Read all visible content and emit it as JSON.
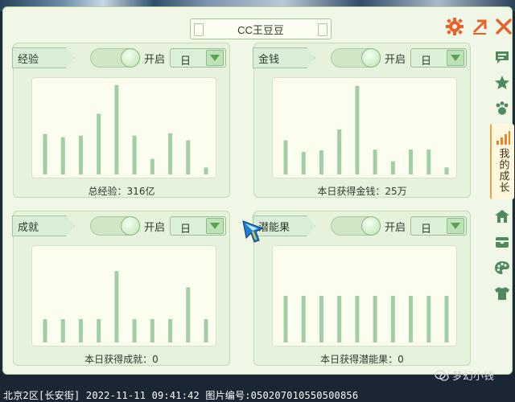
{
  "window": {
    "title": "CC王豆豆"
  },
  "toolbar": {
    "settings_icon": "gear-icon",
    "expand_icon": "expand-arrow-icon",
    "close_icon": "close-icon",
    "accent": "#e8612b"
  },
  "panels": [
    {
      "label": "经验",
      "toggle_label": "开启",
      "toggle_on": true,
      "period": "日",
      "caption": "总经验：316亿",
      "chart_data": {
        "type": "bar",
        "values": [
          52,
          48,
          50,
          78,
          115,
          50,
          20,
          53,
          44,
          9
        ],
        "ylim": [
          0,
          120
        ]
      }
    },
    {
      "label": "金钱",
      "toggle_label": "开启",
      "toggle_on": true,
      "period": "日",
      "caption": "本日获得金钱：25万",
      "chart_data": {
        "type": "bar",
        "values": [
          44,
          29,
          31,
          58,
          114,
          32,
          17,
          32,
          32,
          9
        ],
        "ylim": [
          0,
          120
        ]
      }
    },
    {
      "label": "成就",
      "toggle_label": "开启",
      "toggle_on": true,
      "period": "日",
      "caption": "本日获得成就：0",
      "chart_data": {
        "type": "bar",
        "values": [
          30,
          30,
          30,
          30,
          92,
          30,
          30,
          30,
          71,
          30
        ],
        "ylim": [
          0,
          120
        ]
      }
    },
    {
      "label": "潜能果",
      "toggle_label": "开启",
      "toggle_on": true,
      "period": "日",
      "caption": "本日获得潜能果：0",
      "chart_data": {
        "type": "bar",
        "values": [
          60,
          60,
          60,
          60,
          60,
          60,
          60,
          60,
          60,
          60
        ],
        "ylim": [
          0,
          120
        ]
      }
    }
  ],
  "sidenav": {
    "items": [
      {
        "icon": "chat-icon"
      },
      {
        "icon": "star-icon"
      },
      {
        "icon": "paw-icon"
      },
      {
        "icon": "growth-chart-icon",
        "label": "我的成长",
        "active": true
      },
      {
        "icon": "home-icon"
      },
      {
        "icon": "chest-icon"
      },
      {
        "icon": "palette-icon"
      },
      {
        "icon": "shirt-icon"
      }
    ]
  },
  "status_bar": {
    "text": "北京2区[长安街] 2022-11-11 09:41:42 图片编号:050207010550500856"
  },
  "watermark": {
    "text": "梦幻小钱"
  },
  "colors": {
    "bar": "#a5cda5",
    "panel": "#e7f2dc",
    "chart_bg": "#fbfdef",
    "active_nav": "#fff8dc"
  }
}
